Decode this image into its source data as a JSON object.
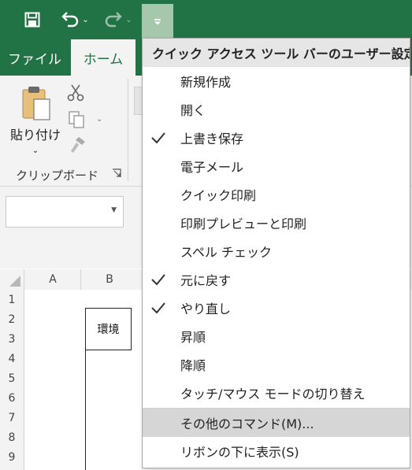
{
  "qat": {
    "save_icon": "save-icon",
    "undo_icon": "undo-icon",
    "redo_icon": "redo-icon",
    "customize_icon": "customize-qat-icon"
  },
  "tabs": [
    {
      "label": "ファイル"
    },
    {
      "label": "ホーム"
    }
  ],
  "ribbon": {
    "paste_label": "貼り付け",
    "group_label": "クリップボード"
  },
  "grid": {
    "columns": [
      "A",
      "B"
    ],
    "rows": [
      "1",
      "2",
      "3",
      "4",
      "5",
      "6",
      "7",
      "8",
      "9"
    ],
    "cell_b2": "環境"
  },
  "menu": {
    "title": "クイック アクセス ツール バーのユーザー設定",
    "items": [
      {
        "label": "新規作成",
        "checked": false
      },
      {
        "label": "開く",
        "checked": false
      },
      {
        "label": "上書き保存",
        "checked": true
      },
      {
        "label": "電子メール",
        "checked": false
      },
      {
        "label": "クイック印刷",
        "checked": false
      },
      {
        "label": "印刷プレビューと印刷",
        "checked": false
      },
      {
        "label": "スペル チェック",
        "checked": false
      },
      {
        "label": "元に戻す",
        "checked": true
      },
      {
        "label": "やり直し",
        "checked": true
      },
      {
        "label": "昇順",
        "checked": false
      },
      {
        "label": "降順",
        "checked": false
      },
      {
        "label": "タッチ/マウス モードの切り替え",
        "checked": false
      }
    ],
    "more_commands": "その他のコマンド(M)...",
    "show_below": "リボンの下に表示(S)"
  },
  "colors": {
    "accent": "#217346",
    "qat_active": "#a5c8ad"
  }
}
